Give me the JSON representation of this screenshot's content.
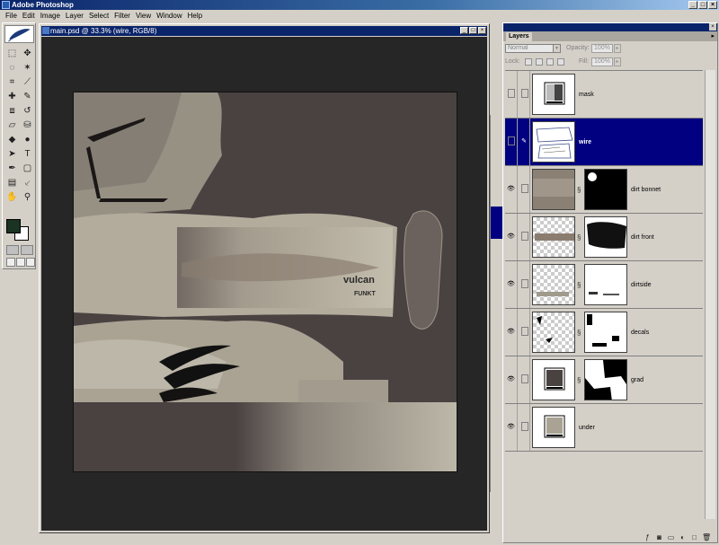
{
  "app": {
    "title": "Adobe Photoshop"
  },
  "window_buttons": {
    "minimize": "_",
    "maximize": "□",
    "close": "×"
  },
  "menu": [
    "File",
    "Edit",
    "Image",
    "Layer",
    "Select",
    "Filter",
    "View",
    "Window",
    "Help"
  ],
  "document": {
    "title": "main.psd @ 33.3% (wire, RGB/8)"
  },
  "toolbox": {
    "tools": [
      "marquee-tool",
      "move-tool",
      "lasso-tool",
      "magic-wand-tool",
      "crop-tool",
      "slice-tool",
      "healing-brush-tool",
      "brush-tool",
      "clone-stamp-tool",
      "history-brush-tool",
      "eraser-tool",
      "paint-bucket-tool",
      "blur-tool",
      "dodge-tool",
      "path-selection-tool",
      "type-tool",
      "pen-tool",
      "shape-tool",
      "notes-tool",
      "eyedropper-tool",
      "hand-tool",
      "zoom-tool"
    ],
    "foreground_color": "#1a3322",
    "background_color": "#ffffff"
  },
  "layers_panel": {
    "tab_label": "Layers",
    "blend_mode": "Normal",
    "opacity_label": "Opacity:",
    "opacity_value": "100%",
    "lock_label": "Lock:",
    "fill_label": "Fill:",
    "fill_value": "100%",
    "layers": [
      {
        "name": "mask",
        "visible": false,
        "selected": false
      },
      {
        "name": "wire",
        "visible": false,
        "selected": true
      },
      {
        "name": "dirt bonnet",
        "visible": true,
        "selected": false
      },
      {
        "name": "dirt front",
        "visible": true,
        "selected": false
      },
      {
        "name": "dirtside",
        "visible": true,
        "selected": false
      },
      {
        "name": "decals",
        "visible": true,
        "selected": false
      },
      {
        "name": "grad",
        "visible": true,
        "selected": false
      },
      {
        "name": "under",
        "visible": true,
        "selected": false
      }
    ],
    "bottom_icons": [
      "layer-style-icon",
      "add-mask-icon",
      "new-set-icon",
      "adjustment-layer-icon",
      "new-layer-icon",
      "trash-icon"
    ]
  },
  "colors": {
    "selection": "#000080",
    "titlebar": "#0a246a",
    "canvas_bg": "#262626"
  }
}
